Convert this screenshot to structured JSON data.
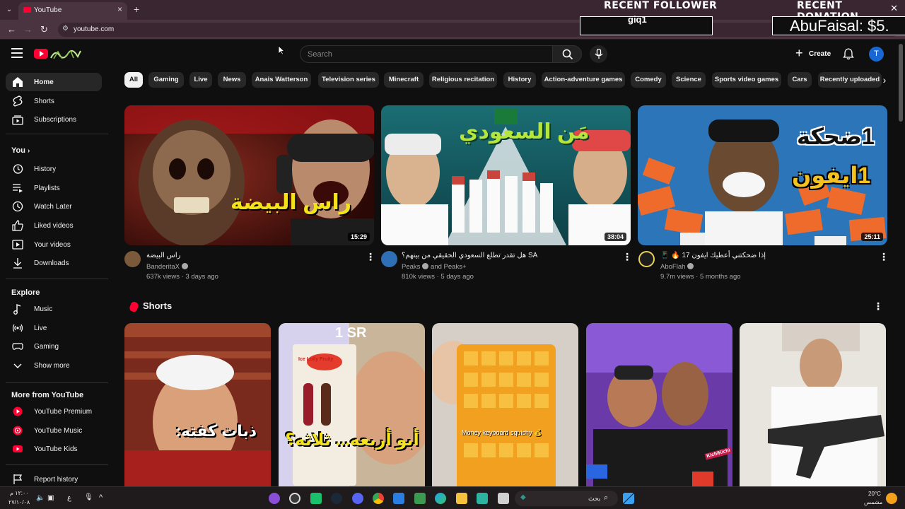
{
  "browser": {
    "tab_title": "YouTube",
    "url": "youtube.com"
  },
  "overlay": {
    "follower_label": "RECENT FOLLOWER",
    "follower_name": "giq1",
    "donation_label": "RECENT DONATION",
    "donation_value": "AbuFaisal: $5."
  },
  "header": {
    "search_placeholder": "Search",
    "create_label": "Create",
    "avatar_initial": "T"
  },
  "sidebar": {
    "main": [
      {
        "label": "Home",
        "icon": "home-icon"
      },
      {
        "label": "Shorts",
        "icon": "shorts-icon"
      },
      {
        "label": "Subscriptions",
        "icon": "subscriptions-icon"
      }
    ],
    "you_heading": "You",
    "you": [
      {
        "label": "History",
        "icon": "history-icon"
      },
      {
        "label": "Playlists",
        "icon": "playlists-icon"
      },
      {
        "label": "Watch Later",
        "icon": "watch-later-icon"
      },
      {
        "label": "Liked videos",
        "icon": "like-icon"
      },
      {
        "label": "Your videos",
        "icon": "your-videos-icon"
      },
      {
        "label": "Downloads",
        "icon": "download-icon"
      }
    ],
    "explore_heading": "Explore",
    "explore": [
      {
        "label": "Music",
        "icon": "music-icon"
      },
      {
        "label": "Live",
        "icon": "live-icon"
      },
      {
        "label": "Gaming",
        "icon": "gaming-icon"
      },
      {
        "label": "Show more",
        "icon": "chevron-down-icon"
      }
    ],
    "more_heading": "More from YouTube",
    "more": [
      {
        "label": "YouTube Premium",
        "icon": "youtube-premium-icon"
      },
      {
        "label": "YouTube Music",
        "icon": "youtube-music-icon"
      },
      {
        "label": "YouTube Kids",
        "icon": "youtube-kids-icon"
      }
    ],
    "report": {
      "label": "Report history",
      "icon": "flag-icon"
    }
  },
  "chips": [
    "All",
    "Gaming",
    "Live",
    "News",
    "Anais Watterson",
    "Television series",
    "Minecraft",
    "Religious recitation",
    "History",
    "Action-adventure games",
    "Comedy",
    "Science",
    "Sports video games",
    "Cars",
    "Recently uploaded"
  ],
  "videos": [
    {
      "title": "راس البيضة",
      "channel": "BanderitaX",
      "second_channel": "",
      "meta": "637k views · 3 days ago",
      "duration": "15:29",
      "thumb_text": "راس البيضة"
    },
    {
      "title": "SA هل تقدر تطلع السعودي الحقيقي من بينهم؟",
      "channel": "Peaks",
      "second_channel": "and Peaks+",
      "meta": "810k views · 5 days ago",
      "duration": "38:04",
      "thumb_text": "مَن السعودي"
    },
    {
      "title": "إذا ضحكتني أعطيك ايفون 17 🔥 📱",
      "channel": "AboFlah",
      "second_channel": "",
      "meta": "9.7m views · 5 months ago",
      "duration": "25:11",
      "thumb_text_1": "1ضحكة",
      "thumb_text_2": "1ايفون"
    }
  ],
  "shorts": {
    "title": "Shorts",
    "items": [
      {
        "caption": "ذبات كفته:"
      },
      {
        "caption": "أبو أربعه... ثلاثه؟",
        "price": "1 SR",
        "box_text": "Ice Lolly Fruity"
      },
      {
        "caption": "Money keyboard squishy 💰"
      },
      {
        "caption": "KichiKichi"
      },
      {
        "caption": ""
      }
    ]
  },
  "taskbar": {
    "time": "١٢:٠٠ م",
    "date": "٢٧/١٠/٠٨",
    "lang": "ع",
    "search_text": "بحث",
    "weather_temp": "20°C",
    "weather_desc": "مشمس"
  }
}
